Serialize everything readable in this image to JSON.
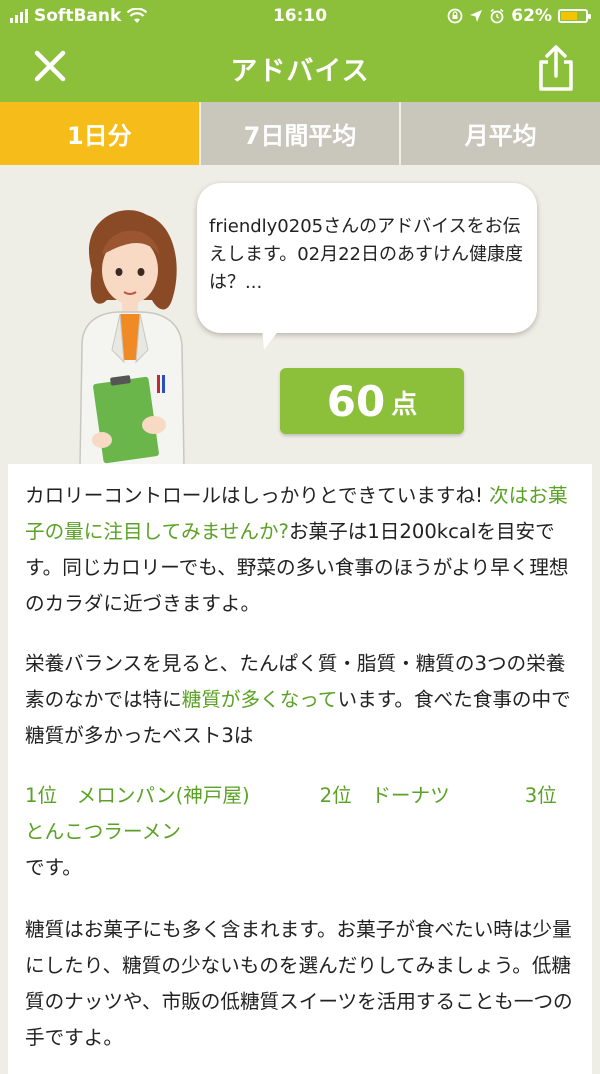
{
  "status_bar": {
    "carrier": "SoftBank",
    "time": "16:10",
    "battery": "62%",
    "battery_level": 0.62
  },
  "nav": {
    "title": "アドバイス",
    "close_icon": "close-icon",
    "share_icon": "share-icon"
  },
  "tabs": [
    {
      "label": "1日分",
      "active": true
    },
    {
      "label": "7日間平均",
      "active": false
    },
    {
      "label": "月平均",
      "active": false
    }
  ],
  "speech": {
    "text": "friendly0205さんのアドバイスをお伝えします。02月22日のあすけん健康度は？..."
  },
  "score": {
    "value": "60",
    "unit": "点"
  },
  "advice": {
    "p1_a": "カロリーコントロールはしっかりとできていますね!",
    "p1_b_green": "次はお菓子の量に注目してみませんか?",
    "p1_c": "お菓子は1日200kcalを目安です。同じカロリーでも、野菜の多い食事のほうがより早く理想のカラダに近づきますよ。",
    "p2_a": "栄養バランスを見ると、たんぱく質・脂質・糖質の3つの栄養素のなかでは特に",
    "p2_b_green": "糖質が多くなって",
    "p2_c": "います。食べた食事の中で糖質が多かったベスト3は",
    "rank1": "1位　メロンパン(神戸屋)",
    "rank2": "2位　ドーナツ",
    "rank3": "3位　とんこつラーメン",
    "p3_end": "です。",
    "p4": "糖質はお菓子にも多く含まれます。お菓子が食べたい時は少量にしたり、糖質の少ないものを選んだりしてみましょう。低糖質のナッツや、市販の低糖質スイーツを活用することも一つの手ですよ。"
  },
  "colors": {
    "header_green": "#8cbf3a",
    "tab_active": "#f5bc1a",
    "tab_inactive": "#c9c6bc",
    "highlight_green": "#5aa225",
    "background": "#efeee6"
  }
}
